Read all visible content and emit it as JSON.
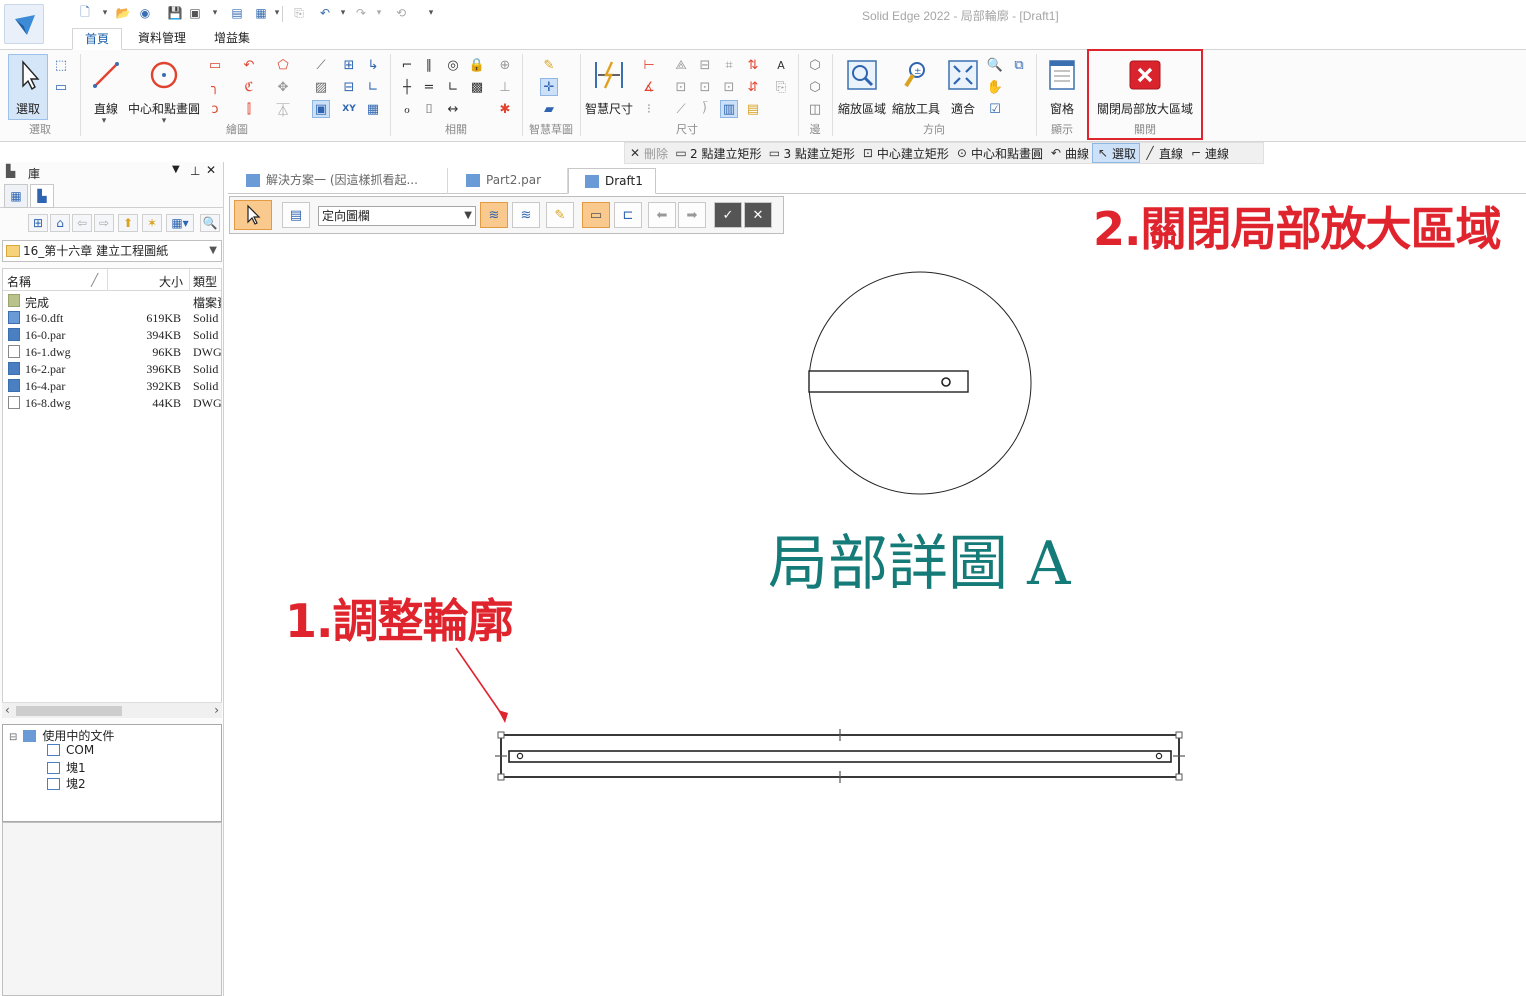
{
  "window": {
    "title": "Solid Edge 2022 - 局部輪廓 - [Draft1]"
  },
  "ribbon_tabs": [
    {
      "label": "首頁"
    },
    {
      "label": "資料管理"
    },
    {
      "label": "增益集"
    }
  ],
  "ribbon": {
    "select": {
      "label": "選取",
      "group": "選取"
    },
    "line": {
      "label": "直線"
    },
    "circle": {
      "label": "中心和點畫圓"
    },
    "draw_group": "繪圖",
    "relate_group": "相關",
    "intellisketch_group": "智慧草圖",
    "smart_dim": {
      "label": "智慧尺寸"
    },
    "dim_group": "尺寸",
    "edge_group": "邊",
    "zoom_area": {
      "label": "縮放區域"
    },
    "zoom_tool": {
      "label": "縮放工具"
    },
    "fit": {
      "label": "適合"
    },
    "orient_group": "方向",
    "window_btn": {
      "label": "窗格"
    },
    "show_group": "顯示",
    "close_detail": {
      "label": "關閉局部放大區域"
    },
    "close_group": "關閉"
  },
  "cmdbar": [
    {
      "icon": "delete-icon",
      "label": "刪除",
      "muted": true
    },
    {
      "icon": "rect-2pt-icon",
      "label": "2 點建立矩形"
    },
    {
      "icon": "rect-3pt-icon",
      "label": "3 點建立矩形"
    },
    {
      "icon": "rect-center-icon",
      "label": "中心建立矩形"
    },
    {
      "icon": "circle-center-icon",
      "label": "中心和點畫圓"
    },
    {
      "icon": "curve-icon",
      "label": "曲線"
    },
    {
      "icon": "pointer-icon",
      "label": "選取",
      "active": true
    },
    {
      "icon": "line-icon",
      "label": "直線"
    },
    {
      "icon": "polyline-icon",
      "label": "連線"
    }
  ],
  "library": {
    "title": "庫",
    "folder": "16_第十六章 建立工程圖紙",
    "columns": {
      "name": "名稱",
      "size": "大小",
      "type": "類型"
    },
    "files": [
      {
        "name": "完成",
        "size": "",
        "type": "檔案資",
        "kind": "folder"
      },
      {
        "name": "16-0.dft",
        "size": "619KB",
        "type": "Solid I",
        "kind": "dft"
      },
      {
        "name": "16-0.par",
        "size": "394KB",
        "type": "Solid I",
        "kind": "par"
      },
      {
        "name": "16-1.dwg",
        "size": "96KB",
        "type": "DWG",
        "kind": "dwg"
      },
      {
        "name": "16-2.par",
        "size": "396KB",
        "type": "Solid I",
        "kind": "par"
      },
      {
        "name": "16-4.par",
        "size": "392KB",
        "type": "Solid I",
        "kind": "par"
      },
      {
        "name": "16-8.dwg",
        "size": "44KB",
        "type": "DWG",
        "kind": "dwg"
      }
    ],
    "tree": {
      "root": "使用中的文件",
      "items": [
        "COM",
        "塊1",
        "塊2"
      ]
    }
  },
  "doc_tabs": [
    {
      "label": "解決方案一 (因這樣抓看起...",
      "active": false
    },
    {
      "label": "Part2.par",
      "active": false
    },
    {
      "label": "Draft1",
      "active": true
    }
  ],
  "float_bar": {
    "combo_value": "定向圖欄"
  },
  "canvas": {
    "detail_caption": "局部詳圖 A",
    "annotation_step1": "1.調整輪廓",
    "annotation_step2": "2.關閉局部放大區域",
    "accent_color": "#e0242e",
    "caption_color": "#157b78"
  }
}
